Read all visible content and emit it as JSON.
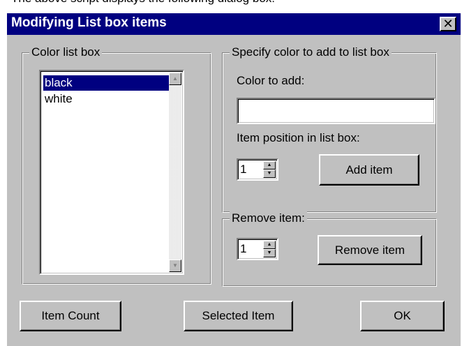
{
  "caption": "The above script displays the following dialog box:",
  "dialog": {
    "title": "Modifying List box items",
    "close_glyph": "✕"
  },
  "color_list": {
    "group_label": "Color list box",
    "items": [
      {
        "label": "black",
        "selected": true
      },
      {
        "label": "white",
        "selected": false
      }
    ]
  },
  "add_group": {
    "group_label": "Specify color to add to list box",
    "color_label": "Color to add:",
    "color_value": "",
    "position_label": "Item position in list box:",
    "position_value": "1",
    "add_button": "Add item"
  },
  "remove_group": {
    "group_label": "Remove item:",
    "position_value": "1",
    "remove_button": "Remove item"
  },
  "footer": {
    "item_count_button": "Item Count",
    "selected_item_button": "Selected Item",
    "ok_button": "OK"
  },
  "colors": {
    "titlebar": "#000080",
    "face": "#c0c0c0",
    "selection": "#000080"
  },
  "icons": {
    "scroll_up": "scroll-up-arrow-icon",
    "scroll_down": "scroll-down-arrow-icon",
    "spin_up": "spin-up-arrow-icon",
    "spin_down": "spin-down-arrow-icon",
    "close": "close-icon"
  }
}
